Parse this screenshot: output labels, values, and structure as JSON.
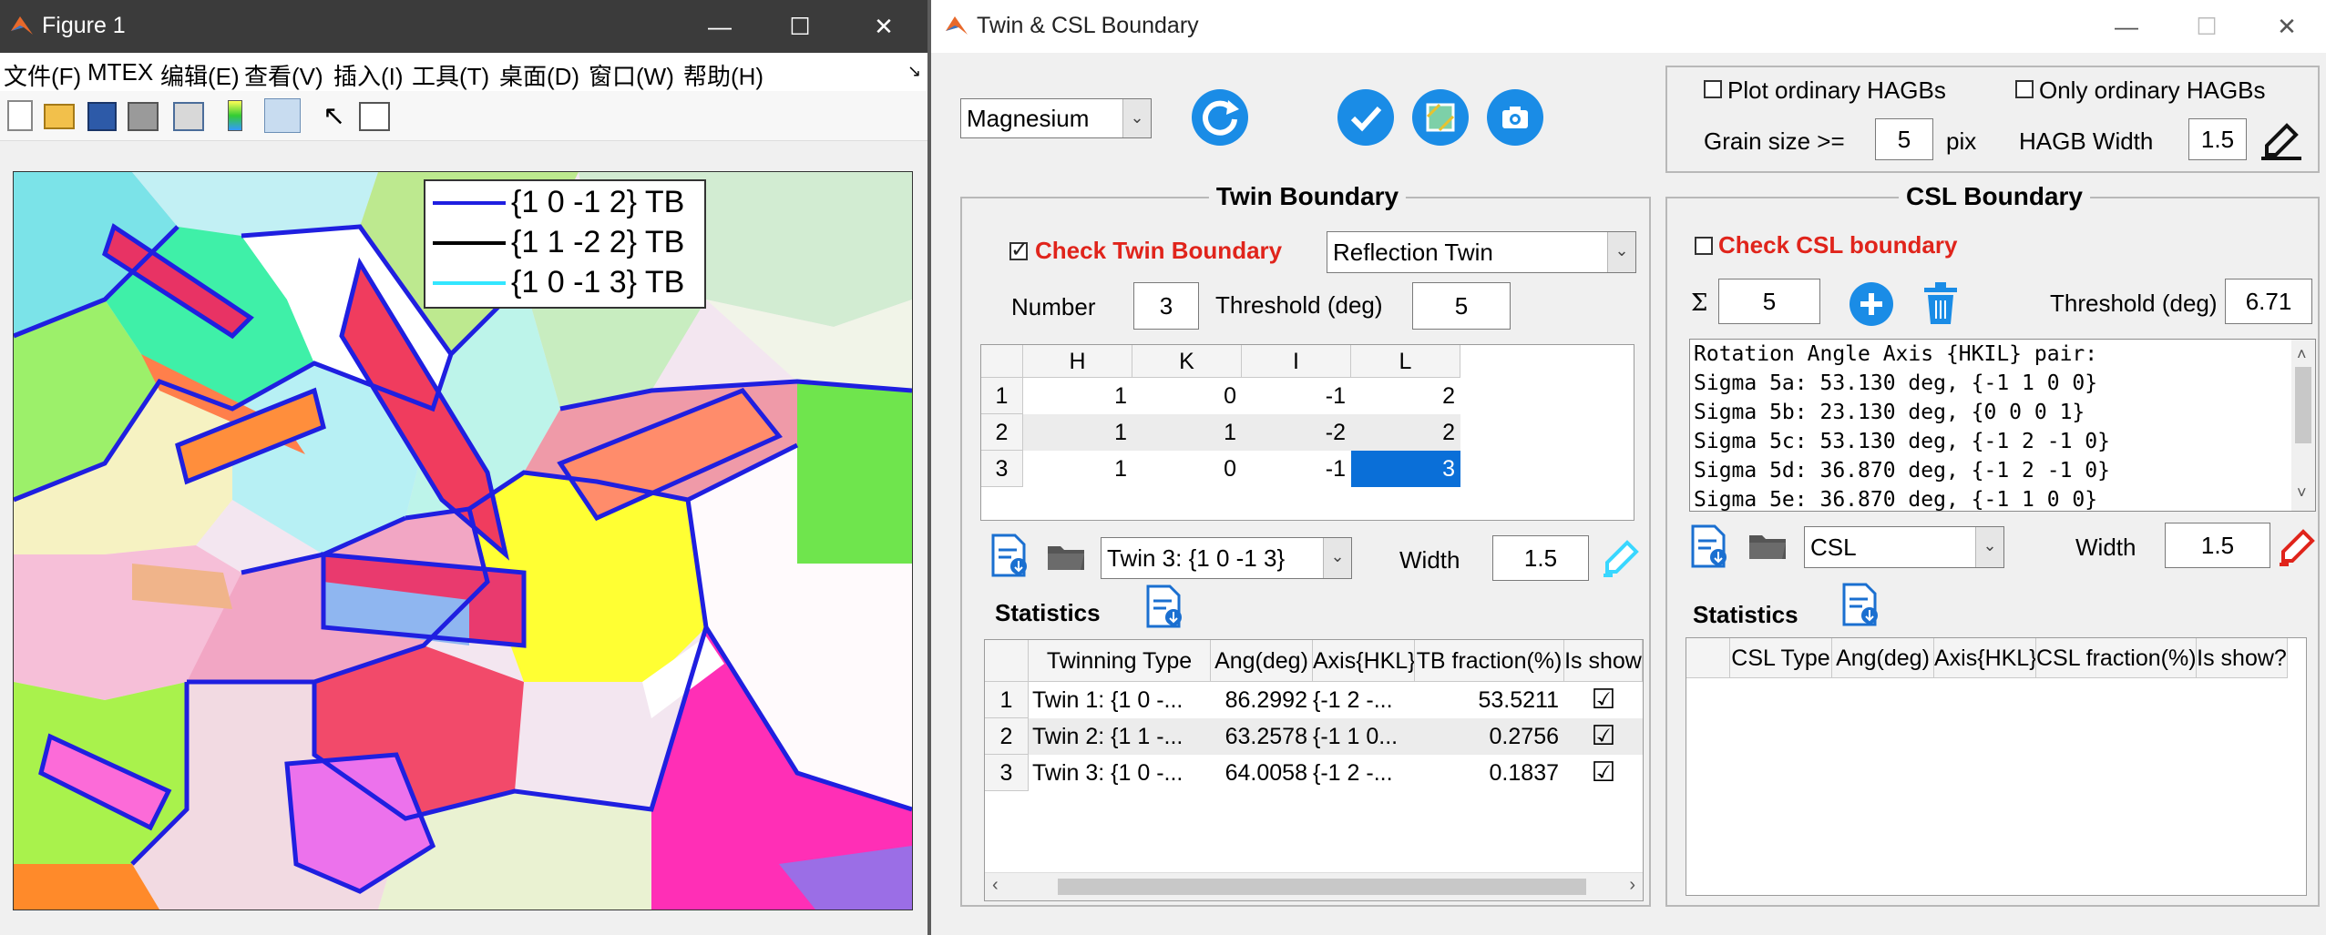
{
  "figure_window": {
    "title": "Figure 1",
    "menu": [
      "文件(F)",
      "MTEX",
      "编辑(E)",
      "查看(V)",
      "插入(I)",
      "工具(T)",
      "桌面(D)",
      "窗口(W)",
      "帮助(H)"
    ],
    "legend": [
      "{1 0 -1 2} TB",
      "{1 1 -2 2} TB",
      "{1 0 -1 3} TB"
    ],
    "legend_colors": [
      "#1f1fe0",
      "#000000",
      "#33e6ff"
    ]
  },
  "app_window": {
    "title": "Twin & CSL Boundary",
    "phase": "Magnesium",
    "plot_ordinary_hagbs": "Plot ordinary HAGBs",
    "only_ordinary_hagbs": "Only ordinary HAGBs",
    "grain_size_label": "Grain size >=",
    "grain_size_value": "5",
    "grain_size_unit": "pix",
    "hagb_width_label": "HAGB Width",
    "hagb_width_value": "1.5",
    "twin": {
      "panel_title": "Twin Boundary",
      "check_label": "Check Twin Boundary",
      "checked": true,
      "twin_type": "Reflection Twin",
      "number_label": "Number",
      "number_value": "3",
      "threshold_label": "Threshold (deg)",
      "threshold_value": "5",
      "hkil_headers": [
        "H",
        "K",
        "I",
        "L"
      ],
      "hkil_rows": [
        [
          "1",
          "1",
          "0",
          "-1",
          "2"
        ],
        [
          "2",
          "1",
          "1",
          "-2",
          "2"
        ],
        [
          "3",
          "1",
          "0",
          "-1",
          "3"
        ]
      ],
      "selected_twin": "Twin 3: {1 0 -1 3}",
      "width_label": "Width",
      "width_value": "1.5",
      "statistics_label": "Statistics",
      "stats_headers": [
        "Twinning Type",
        "Ang(deg)",
        "Axis{HKL}",
        "TB fraction(%)",
        "Is show"
      ],
      "stats_rows": [
        [
          "1",
          "Twin 1: {1 0 -...",
          "86.2992",
          "{-1 2 -...",
          "53.5211",
          "☑"
        ],
        [
          "2",
          "Twin 2: {1 1 -...",
          "63.2578",
          "{-1 1 0...",
          "0.2756",
          "☑"
        ],
        [
          "3",
          "Twin 3: {1 0 -...",
          "64.0058",
          "{-1 2 -...",
          "0.1837",
          "☑"
        ]
      ]
    },
    "csl": {
      "panel_title": "CSL Boundary",
      "check_label": "Check CSL boundary",
      "checked": false,
      "sigma_symbol": "Σ",
      "sigma_value": "5",
      "threshold_label": "Threshold (deg)",
      "threshold_value": "6.71",
      "info_lines": [
        "Rotation Angle Axis {HKIL} pair:",
        "Sigma 5a: 53.130 deg, {-1 1 0 0}",
        "Sigma 5b: 23.130 deg, {0 0 0 1}",
        "Sigma 5c: 53.130 deg, {-1 2 -1 0}",
        "Sigma 5d: 36.870 deg, {-1 2 -1 0}",
        "Sigma 5e: 36.870 deg, {-1 1 0 0}"
      ],
      "csl_type": "CSL",
      "width_label": "Width",
      "width_value": "1.5",
      "statistics_label": "Statistics",
      "stats_headers": [
        "CSL Type",
        "Ang(deg)",
        "Axis{HKL}",
        "CSL fraction(%)",
        "Is show?"
      ]
    }
  }
}
